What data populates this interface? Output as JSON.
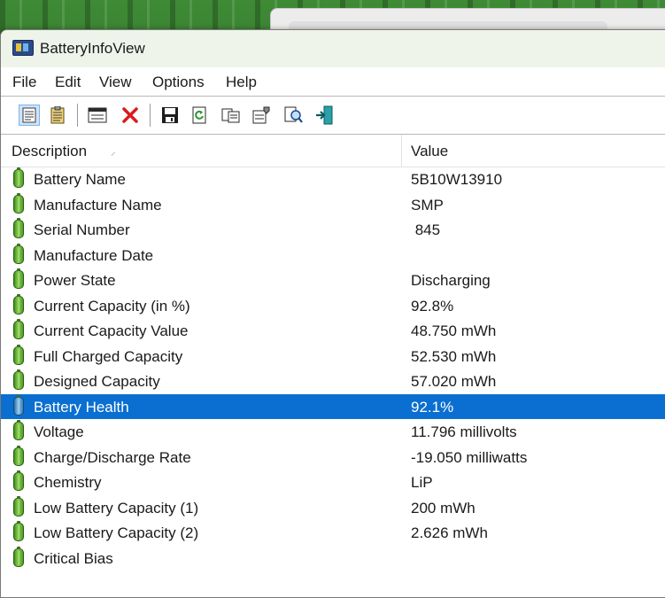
{
  "window": {
    "title": "BatteryInfoView"
  },
  "menu": [
    "File",
    "Edit",
    "View",
    "Options",
    "Help"
  ],
  "toolbar": [
    {
      "icon": "html-report-icon",
      "pressed": true
    },
    {
      "icon": "text-report-icon",
      "pressed": false
    },
    {
      "icon": "separator"
    },
    {
      "icon": "properties-window-icon",
      "pressed": false
    },
    {
      "icon": "close-red-x-icon",
      "pressed": false
    },
    {
      "icon": "separator"
    },
    {
      "icon": "save-icon",
      "pressed": false
    },
    {
      "icon": "refresh-icon",
      "pressed": false
    },
    {
      "icon": "copy-icon",
      "pressed": false
    },
    {
      "icon": "properties-icon",
      "pressed": false
    },
    {
      "icon": "find-icon",
      "pressed": false
    },
    {
      "icon": "exit-icon",
      "pressed": false
    }
  ],
  "columns": {
    "description": "Description",
    "value": "Value"
  },
  "rows": [
    {
      "description": "Battery Name",
      "value": "5B10W13910"
    },
    {
      "description": "Manufacture Name",
      "value": "SMP"
    },
    {
      "description": "Serial Number",
      "value": " 845"
    },
    {
      "description": "Manufacture Date",
      "value": ""
    },
    {
      "description": "Power State",
      "value": "Discharging"
    },
    {
      "description": "Current Capacity (in %)",
      "value": "92.8%"
    },
    {
      "description": "Current Capacity Value",
      "value": "48.750 mWh"
    },
    {
      "description": "Full Charged Capacity",
      "value": "52.530 mWh"
    },
    {
      "description": "Designed Capacity",
      "value": "57.020 mWh"
    },
    {
      "description": "Battery Health",
      "value": "92.1%",
      "selected": true
    },
    {
      "description": "Voltage",
      "value": "11.796 millivolts"
    },
    {
      "description": "Charge/Discharge Rate",
      "value": "-19.050 milliwatts"
    },
    {
      "description": "Chemistry",
      "value": "LiP"
    },
    {
      "description": "Low Battery Capacity (1)",
      "value": "200 mWh"
    },
    {
      "description": "Low Battery Capacity (2)",
      "value": "2.626 mWh"
    },
    {
      "description": "Critical Bias",
      "value": ""
    }
  ],
  "colors": {
    "selection": "#0a6fd0",
    "battery_green": "#5cb82a"
  }
}
